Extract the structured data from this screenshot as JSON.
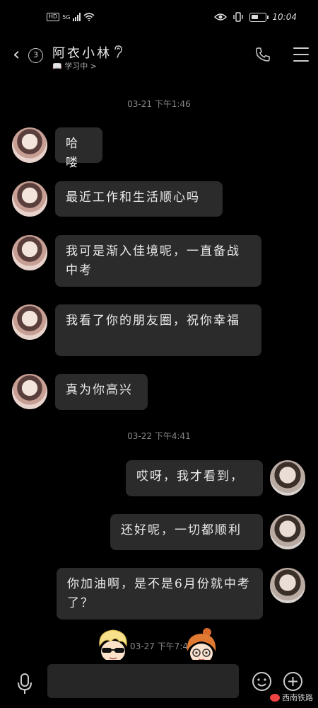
{
  "status_bar": {
    "left_badge": "HD",
    "network": "5G",
    "time": "10:04"
  },
  "header": {
    "back_count": "3",
    "contact_name": "阿衣小林",
    "status_text": "📖 学习中 >"
  },
  "messages": [
    {
      "type": "timestamp",
      "text": "03-21 下午1:46"
    },
    {
      "type": "incoming",
      "text": "哈喽"
    },
    {
      "type": "incoming",
      "text": "最近工作和生活顺心吗"
    },
    {
      "type": "incoming",
      "text": "我可是渐入佳境呢，一直备战中考"
    },
    {
      "type": "incoming",
      "text": "我看了你的朋友圈，祝你幸福"
    },
    {
      "type": "incoming",
      "text": "真为你高兴"
    },
    {
      "type": "timestamp",
      "text": "03-22 下午4:41"
    },
    {
      "type": "outgoing",
      "text": "哎呀，我才看到，"
    },
    {
      "type": "outgoing",
      "text": "还好呢，一切都顺利"
    },
    {
      "type": "outgoing",
      "text": "你加油啊，是不是6月份就中考了？"
    },
    {
      "type": "timestamp",
      "text": "03-27 下午7:4"
    }
  ],
  "watermark": "西南铁路",
  "icons": [
    "back-chevron-icon",
    "ear-icon",
    "phone-icon",
    "menu-icon",
    "mic-icon",
    "emoji-icon",
    "plus-icon"
  ]
}
